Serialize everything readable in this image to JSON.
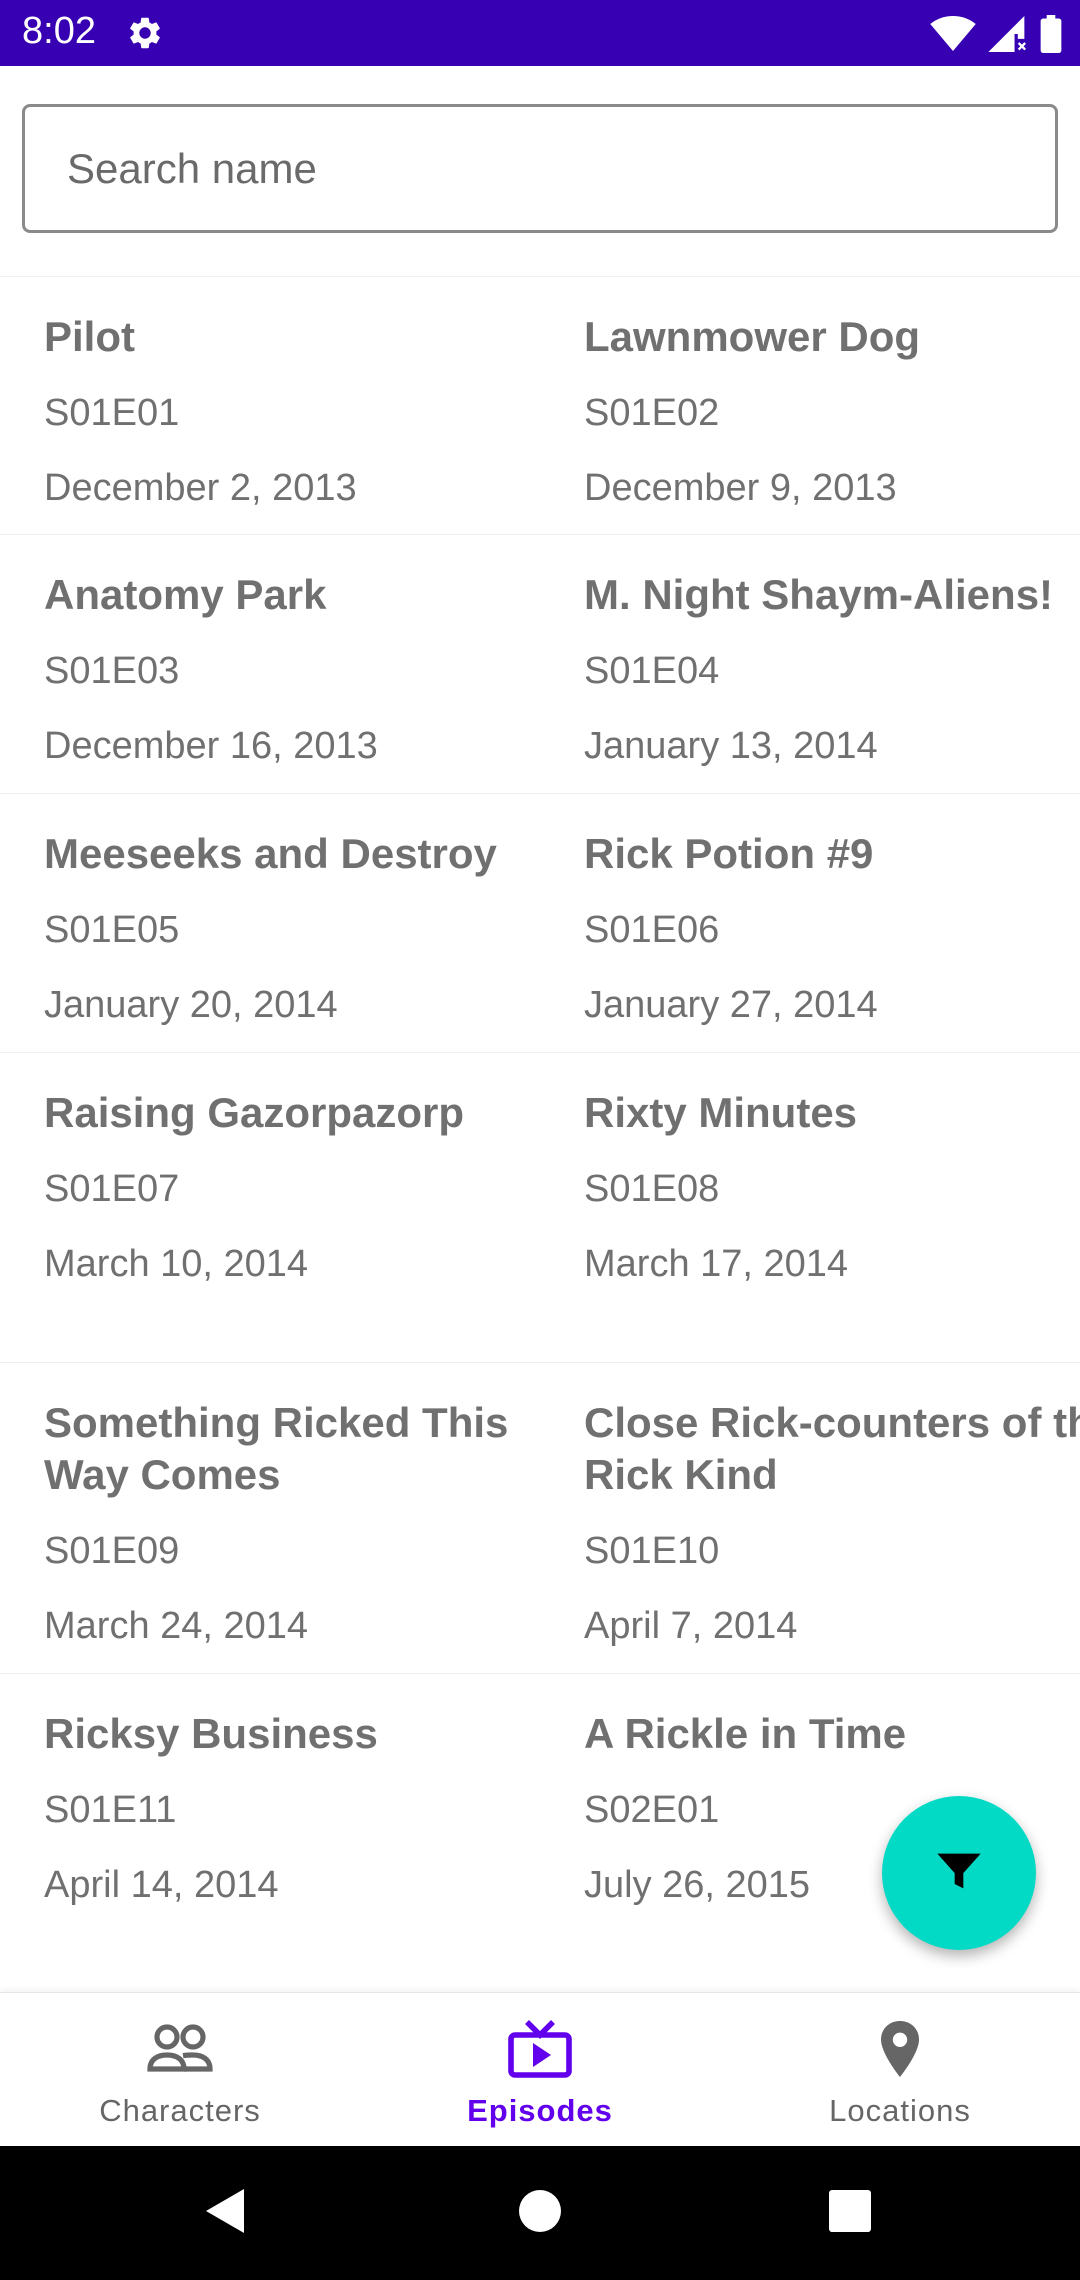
{
  "status_bar": {
    "time": "8:02",
    "icons": [
      "gear-icon",
      "wifi-icon",
      "signal-icon",
      "battery-icon"
    ],
    "color": "#3700b3"
  },
  "search": {
    "placeholder": "Search name",
    "value": ""
  },
  "episodes": [
    {
      "name": "Pilot",
      "code": "S01E01",
      "air_date": "December 2, 2013"
    },
    {
      "name": "Lawnmower Dog",
      "code": "S01E02",
      "air_date": "December 9, 2013"
    },
    {
      "name": "Anatomy Park",
      "code": "S01E03",
      "air_date": "December 16, 2013"
    },
    {
      "name": "M. Night Shaym-Aliens!",
      "code": "S01E04",
      "air_date": "January 13, 2014"
    },
    {
      "name": "Meeseeks and Destroy",
      "code": "S01E05",
      "air_date": "January 20, 2014"
    },
    {
      "name": "Rick Potion #9",
      "code": "S01E06",
      "air_date": "January 27, 2014"
    },
    {
      "name": "Raising Gazorpazorp",
      "code": "S01E07",
      "air_date": "March 10, 2014"
    },
    {
      "name": "Rixty Minutes",
      "code": "S01E08",
      "air_date": "March 17, 2014"
    },
    {
      "name": "Something Ricked This\nWay Comes",
      "code": "S01E09",
      "air_date": "March 24, 2014"
    },
    {
      "name": "Close Rick-counters of the\nRick Kind",
      "code": "S01E10",
      "air_date": "April 7, 2014"
    },
    {
      "name": "Ricksy Business",
      "code": "S01E11",
      "air_date": "April 14, 2014"
    },
    {
      "name": "A Rickle in Time",
      "code": "S02E01",
      "air_date": "July 26, 2015"
    }
  ],
  "fab": {
    "icon": "filter-icon",
    "color": "#03dac5"
  },
  "bottom_nav": {
    "items": [
      {
        "label": "Characters",
        "icon": "people-icon",
        "active": false
      },
      {
        "label": "Episodes",
        "icon": "tv-icon",
        "active": true
      },
      {
        "label": "Locations",
        "icon": "location-pin-icon",
        "active": false
      }
    ],
    "active_color": "#6200ee"
  },
  "system_nav": {
    "buttons": [
      "back-icon",
      "home-icon",
      "recents-icon"
    ]
  }
}
